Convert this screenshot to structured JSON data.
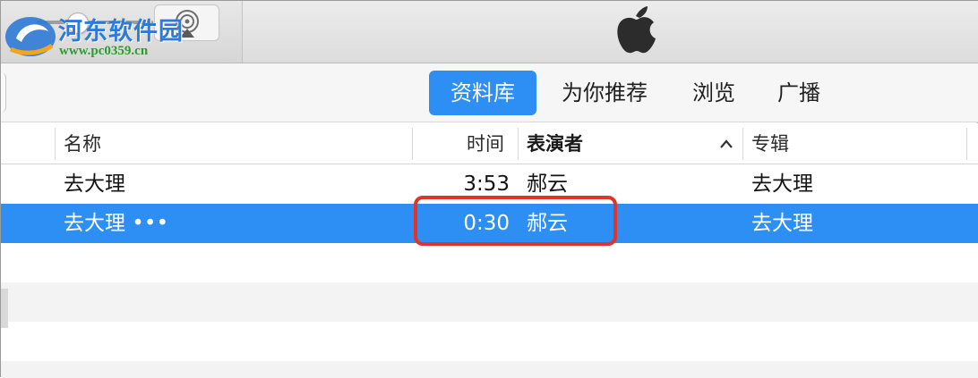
{
  "watermark": {
    "title": "河东软件园",
    "url": "www.pc0359.cn"
  },
  "toolbar": {
    "apple_logo": "apple-logo",
    "airplay_icon": "airplay-icon"
  },
  "nav": {
    "tabs": [
      {
        "label": "资料库",
        "active": true
      },
      {
        "label": "为你推荐",
        "active": false
      },
      {
        "label": "浏览",
        "active": false
      },
      {
        "label": "广播",
        "active": false
      }
    ]
  },
  "table": {
    "columns": [
      "名称",
      "时间",
      "表演者",
      "专辑"
    ],
    "sorted_column": "表演者",
    "rows": [
      {
        "name": "去大理",
        "time": "3:53",
        "artist": "郝云",
        "album": "去大理",
        "selected": false
      },
      {
        "name": "去大理 •••",
        "time": "0:30",
        "artist": "郝云",
        "album": "去大理",
        "selected": true
      }
    ]
  },
  "colors": {
    "accent": "#2d8ff3",
    "highlight": "#e0332b"
  }
}
